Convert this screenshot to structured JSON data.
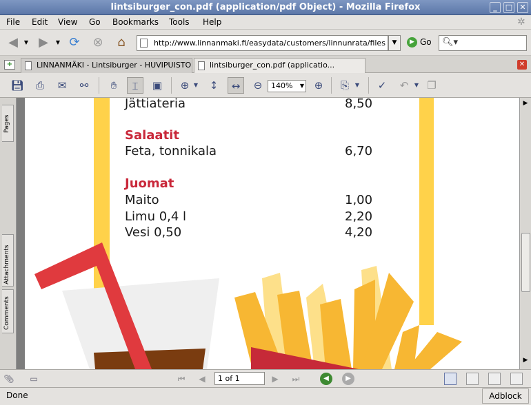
{
  "window": {
    "title": "lintsiburger_con.pdf (application/pdf Object) - Mozilla Firefox"
  },
  "menubar": {
    "items": [
      "File",
      "Edit",
      "View",
      "Go",
      "Bookmarks",
      "Tools",
      "Help"
    ]
  },
  "navbar": {
    "url": "http://www.linnanmaki.fi/easydata/customers/linnunrata/files",
    "go_label": "Go"
  },
  "tabs": [
    {
      "label": "LINNANMÄKI - Lintsiburger - HUVIPUISTO",
      "active": false
    },
    {
      "label": "lintsiburger_con.pdf (applicatio...",
      "active": true
    }
  ],
  "pdf_toolbar": {
    "zoom": "140%"
  },
  "side_tabs": [
    "Pages",
    "Attachments",
    "Comments"
  ],
  "document": {
    "rows": [
      {
        "name": "Jättiateria",
        "price": "8,50"
      }
    ],
    "sections": [
      {
        "heading": "Salaatit",
        "items": [
          {
            "name": "Feta, tonnikala",
            "price": "6,70"
          }
        ]
      },
      {
        "heading": "Juomat",
        "items": [
          {
            "name": "Maito",
            "price": "1,00"
          },
          {
            "name": "Limu 0,4 l",
            "price": "2,20"
          },
          {
            "name": "Vesi 0,50",
            "price": "4,20"
          }
        ]
      }
    ],
    "colors": {
      "heading_red": "#c9283a",
      "yellow_stripe": "#ffd24a",
      "straw_red": "#e03a3e",
      "cup_grey": "#efefef",
      "drink_brown": "#7a3c10",
      "fries_orange": "#f7b733",
      "fries_light": "#fde08a",
      "fries_box_red": "#c62a38"
    }
  },
  "pdf_nav": {
    "page_field": "1 of 1"
  },
  "status": {
    "text": "Done",
    "adblock": "Adblock"
  }
}
